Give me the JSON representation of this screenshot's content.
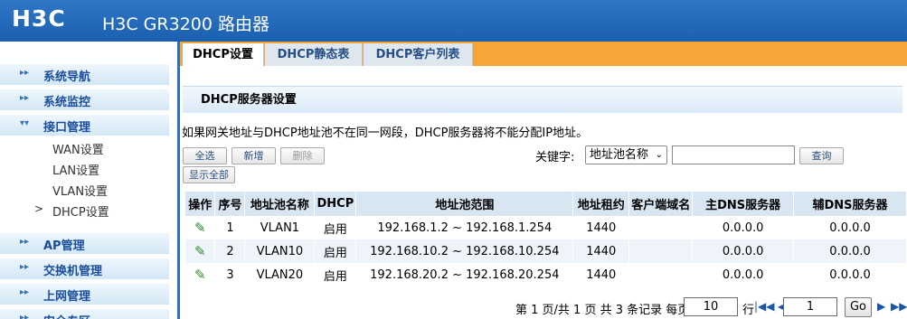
{
  "header": {
    "logo": "H3C",
    "title": "H3C GR3200 路由器"
  },
  "sidebar": {
    "sections": [
      {
        "label": "系统导航"
      },
      {
        "label": "系统监控"
      },
      {
        "label": "接口管理"
      },
      {
        "label": "AP管理"
      },
      {
        "label": "交换机管理"
      },
      {
        "label": "上网管理"
      },
      {
        "label": "安全专区"
      }
    ],
    "subitems": [
      "WAN设置",
      "LAN设置",
      "VLAN设置",
      "DHCP设置"
    ]
  },
  "tabs": [
    {
      "label": "DHCP设置"
    },
    {
      "label": "DHCP静态表"
    },
    {
      "label": "DHCP客户列表"
    }
  ],
  "panel": {
    "title": "DHCP服务器设置",
    "note": "如果网关地址与DHCP地址池不在同一网段，DHCP服务器将不能分配IP地址。"
  },
  "toolbar": {
    "select_all": "全选",
    "add": "新增",
    "delete": "删除",
    "show_all": "显示全部",
    "keyword_label": "关键字:",
    "keyword_option": "地址池名称",
    "search": "查询"
  },
  "table": {
    "headers": [
      "操作",
      "序号",
      "地址池名称",
      "DHCP",
      "地址池范围",
      "地址租约",
      "客户端域名",
      "主DNS服务器",
      "辅DNS服务器"
    ],
    "rows": [
      {
        "seq": "1",
        "name": "VLAN1",
        "dhcp": "启用",
        "range": "192.168.1.2 ~ 192.168.1.254",
        "lease": "1440",
        "domain": "",
        "dns1": "0.0.0.0",
        "dns2": "0.0.0.0"
      },
      {
        "seq": "2",
        "name": "VLAN10",
        "dhcp": "启用",
        "range": "192.168.10.2 ~ 192.168.10.254",
        "lease": "1440",
        "domain": "",
        "dns1": "0.0.0.0",
        "dns2": "0.0.0.0"
      },
      {
        "seq": "3",
        "name": "VLAN20",
        "dhcp": "启用",
        "range": "192.168.20.2 ~ 192.168.20.254",
        "lease": "1440",
        "domain": "",
        "dns1": "0.0.0.0",
        "dns2": "0.0.0.0"
      }
    ]
  },
  "pager": {
    "info": "第 1 页/共 1 页 共 3 条记录 每页",
    "per_page": "10",
    "row_label": "行",
    "page": "1",
    "go": "Go"
  },
  "colors": {
    "header_blue": "#1b5fb0",
    "tab_orange": "#f4a63a",
    "nav_text": "#1a4e9c"
  },
  "icons": {
    "edit": "pencil-icon",
    "nav": "arrow-icon"
  }
}
